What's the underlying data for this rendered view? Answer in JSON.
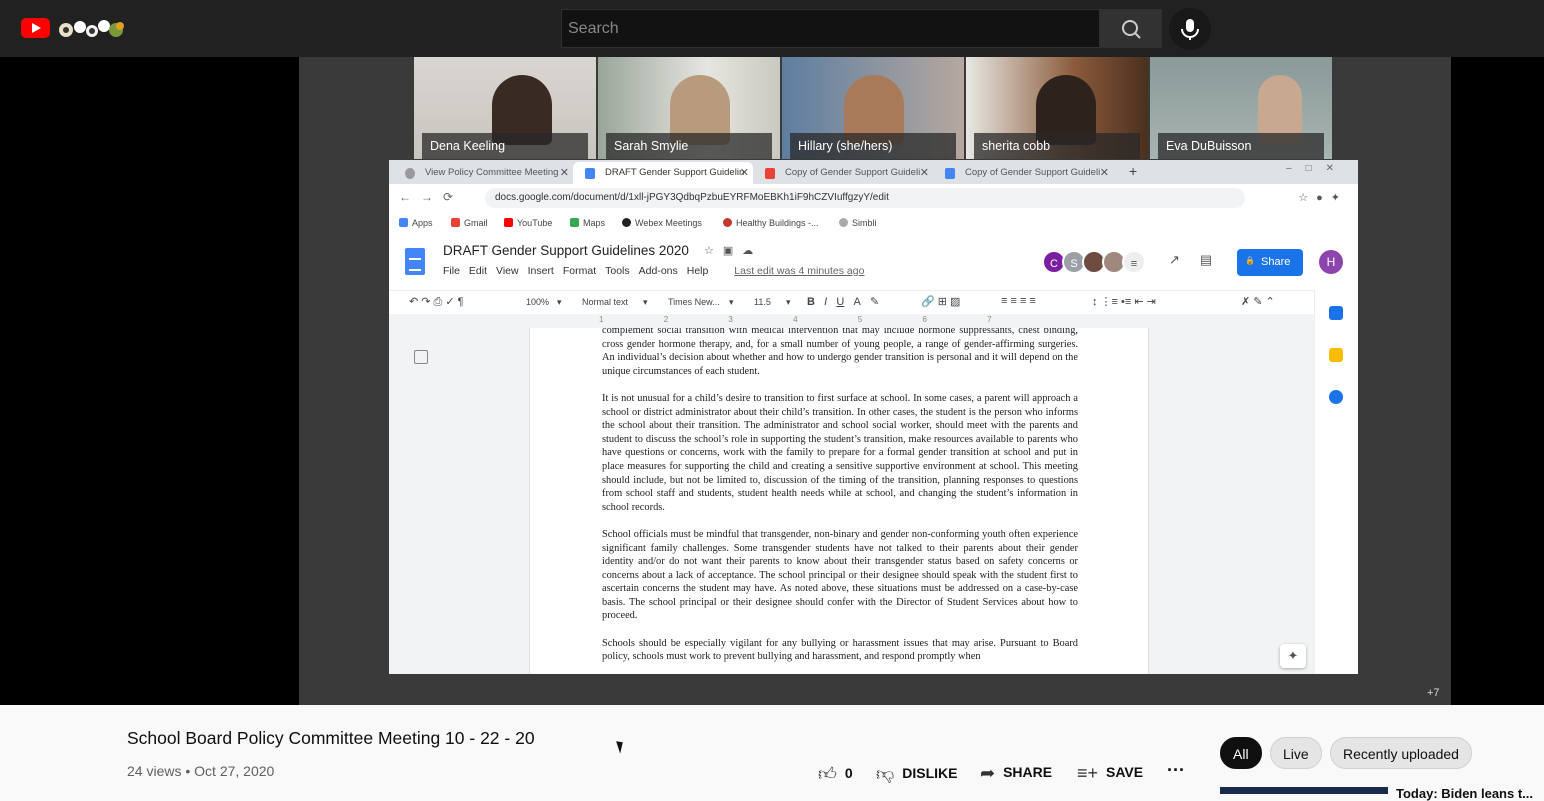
{
  "search": {
    "placeholder": "Search"
  },
  "participants": [
    {
      "name": "Dena Keeling"
    },
    {
      "name": "Sarah Smylie"
    },
    {
      "name": "Hillary (she/hers)"
    },
    {
      "name": "sherita cobb"
    },
    {
      "name": "Eva DuBuisson"
    }
  ],
  "browser": {
    "tabs": [
      {
        "label": "View Policy Committee Meeting"
      },
      {
        "label": "DRAFT Gender Support Guidelin"
      },
      {
        "label": "Copy of Gender Support Guideli"
      },
      {
        "label": "Copy of Gender Support Guideli"
      }
    ],
    "url": "docs.google.com/document/d/1xll-jPGY3QdbqPzbuEYRFMoEBKh1iF9hCZVIuffgzyY/edit",
    "bookmarks": [
      {
        "label": "Apps"
      },
      {
        "label": "Gmail"
      },
      {
        "label": "YouTube"
      },
      {
        "label": "Maps"
      },
      {
        "label": "Webex Meetings"
      },
      {
        "label": "Healthy Buildings -..."
      },
      {
        "label": "Simbli"
      }
    ]
  },
  "doc": {
    "title": "DRAFT Gender Support Guidelines 2020",
    "menu": [
      "File",
      "Edit",
      "View",
      "Insert",
      "Format",
      "Tools",
      "Add-ons",
      "Help"
    ],
    "last_edit": "Last edit was 4 minutes ago",
    "share_label": "Share",
    "collaborators": [
      "C",
      "S"
    ],
    "user_initial": "H",
    "toolbar": {
      "zoom": "100%",
      "style": "Normal text",
      "font": "Times New...",
      "size": "11.5"
    },
    "ruler_marks": [
      "1",
      "2",
      "3",
      "4",
      "5",
      "6",
      "7"
    ],
    "paragraphs": [
      "complement social transition with medical intervention that may include hormone suppressants, chest binding, cross gender hormone therapy, and, for a small number of young people, a range of gender-affirming surgeries. An individual’s decision about whether and how to undergo gender transition is personal and it will depend on the unique circumstances of each student.",
      "It is not unusual for a child’s desire to transition to first surface at school. In some cases, a parent will approach a school or district administrator about their child’s transition. In other cases, the student is the person who informs the school about their transition. The administrator and school social worker, should meet with the parents and student to discuss the school’s role in supporting the student’s transition, make resources available to parents who have questions or concerns, work with the family to prepare for a formal gender transition at school and put in place measures for supporting the child and creating a sensitive supportive environment at school. This meeting should include, but not be limited to, discussion of the timing of the transition, planning responses to questions from school staff and students, student health needs while at school, and changing the student’s information in school records.",
      "School officials must be mindful that transgender, non-binary and gender non-conforming youth often experience significant family challenges. Some transgender students have not talked to their parents about their gender identity and/or do not want their parents to know about their transgender status based on safety concerns or concerns about a lack of acceptance. The school principal or their designee should speak with the student first to ascertain concerns the student may have. As noted above, these situations must be addressed on a case-by-case basis. The school principal or their designee should confer with the Director of Student Services about how to proceed.",
      "Schools should be especially vigilant for any bullying or harassment issues that may arise. Pursuant to Board policy, schools must work to prevent bullying and harassment, and respond promptly when"
    ]
  },
  "overlay": {
    "more_participants": "+7"
  },
  "video": {
    "title": "School Board Policy Committee Meeting 10 - 22 - 20",
    "views": "24 views",
    "date": "Oct 27, 2020",
    "likes": "0",
    "dislike_label": "DISLIKE",
    "share_label": "SHARE",
    "save_label": "SAVE"
  },
  "chips": [
    {
      "label": "All"
    },
    {
      "label": "Live"
    },
    {
      "label": "Recently uploaded"
    }
  ],
  "next_video": {
    "title": "Today: Biden leans t..."
  }
}
